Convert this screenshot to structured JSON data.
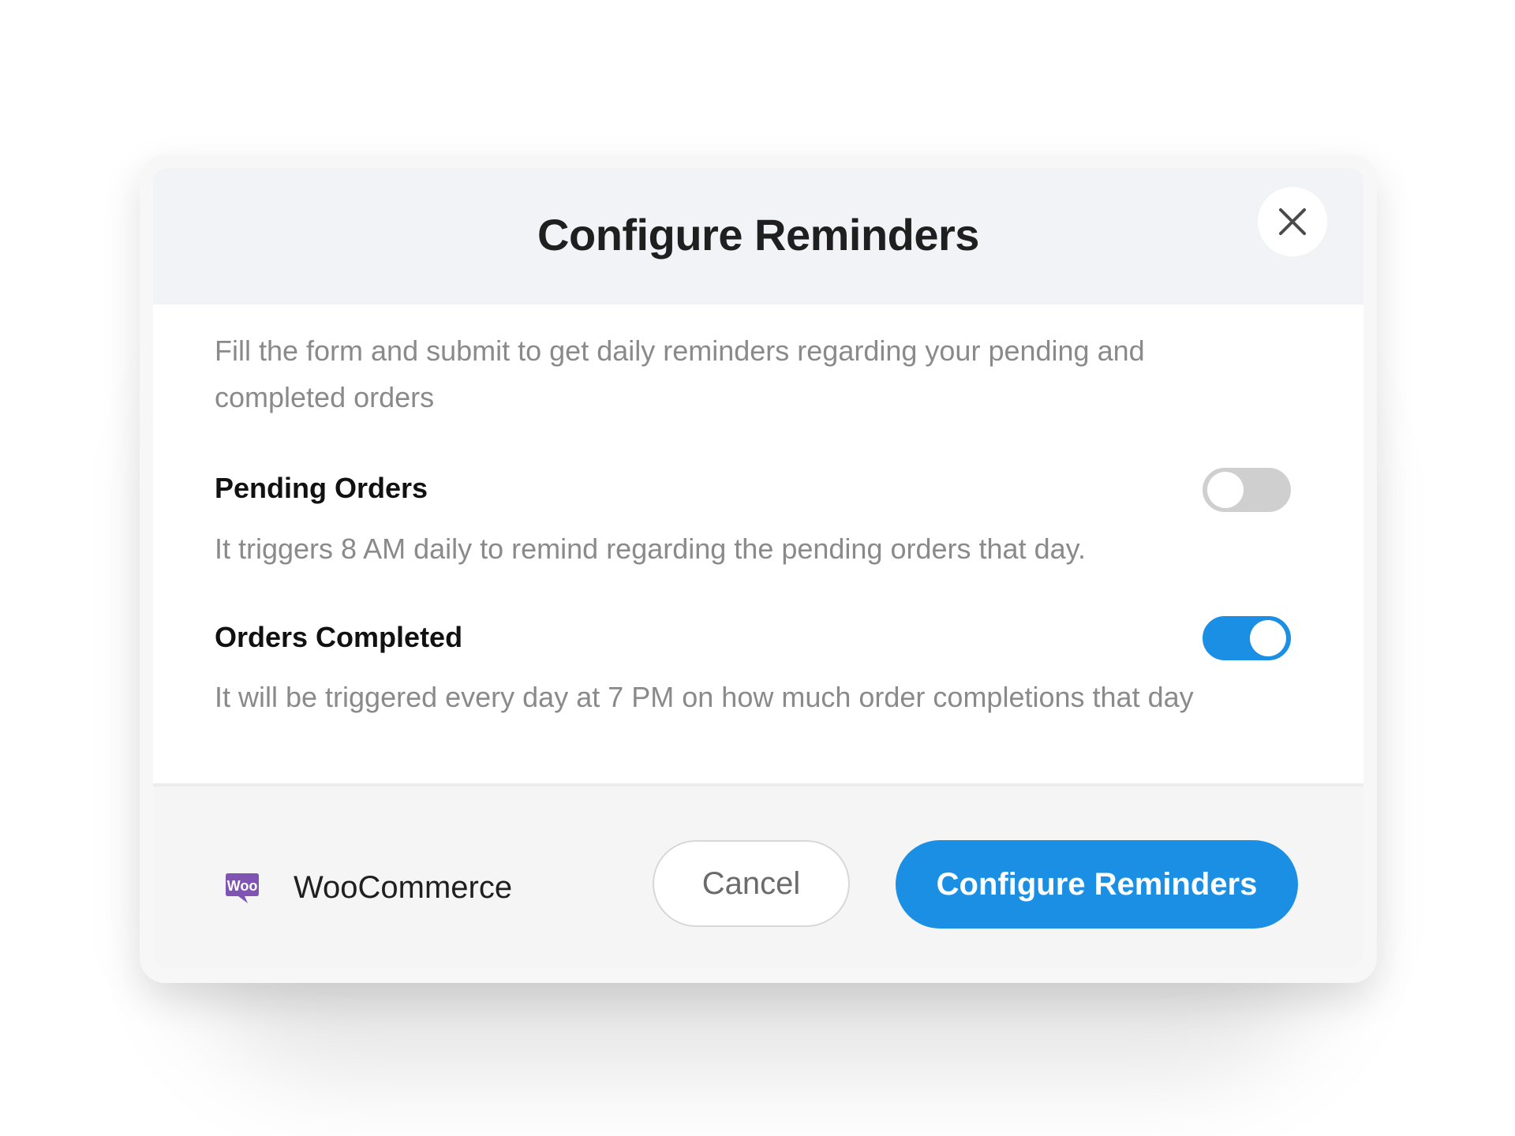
{
  "modal": {
    "title": "Configure Reminders",
    "description": "Fill the form and submit to get daily reminders regarding your pending and completed orders"
  },
  "reminders": [
    {
      "title": "Pending Orders",
      "description": "It triggers 8 AM daily to remind regarding the pending orders that day.",
      "enabled": false
    },
    {
      "title": "Orders Completed",
      "description": "It will be triggered every day at 7 PM on how much order completions that day",
      "enabled": true
    }
  ],
  "footer": {
    "brand_name": "WooCommerce",
    "brand_logo_text": "Woo",
    "cancel_label": "Cancel",
    "submit_label": "Configure Reminders"
  },
  "colors": {
    "accent": "#1b8fe3",
    "woo_purple": "#7f54b3"
  },
  "icons": {
    "close": "close-icon",
    "brand": "woocommerce-logo-icon"
  }
}
